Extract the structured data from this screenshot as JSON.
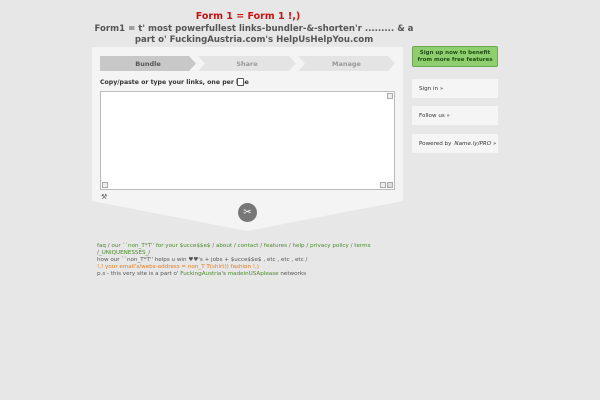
{
  "header": {
    "title": "Form 1 = Form 1 !,)",
    "subtitle": "Form1 = t' most powerfullest links-bundler-&-shorten'r ......... & a part o' FuckingAustria.com's HelpUsHelpYou.com"
  },
  "steps": [
    {
      "label": "Bundle",
      "active": true
    },
    {
      "label": "Share",
      "active": false
    },
    {
      "label": "Manage",
      "active": false
    }
  ],
  "form": {
    "links_label": "Copy/paste or type your links, one per line",
    "links_value": ""
  },
  "sidebar": {
    "signup_label": "Sign up now to benefit from more free features",
    "login_label": "Sign in »",
    "follow_label": "Follow us »",
    "powered_prefix": "Powered by",
    "powered_brand": "Name.ly/PRO »"
  },
  "footer": {
    "links": [
      "faq",
      "our ``non_T*T'' for your $ucce$$e$",
      "about",
      "contact",
      "features",
      "help",
      "privacy policy",
      "terms",
      "_UNIQUENESSES_"
    ],
    "line2": "how our ``non_T*T'' helps u win ♥♥'s + jobs + $ucce$$e$ , etc , etc , etc /",
    "line3": "!,! your email's/webs-address = non_T T(shirt)) fashion !,)",
    "line4_prefix": "p.s - this very site is a part o'",
    "line4_link1": "FuckingAustria",
    "line4_mid": "'s",
    "line4_link2": "madeinUSAplease",
    "line4_suffix": "networks"
  },
  "colors": {
    "title": "#cc1111",
    "accent_green": "#8fcf6f",
    "link_green": "#4a8a2a",
    "orange": "#e87a1a"
  },
  "icons": [
    "doc-icon",
    "wrench-icon",
    "scissors-icon"
  ]
}
